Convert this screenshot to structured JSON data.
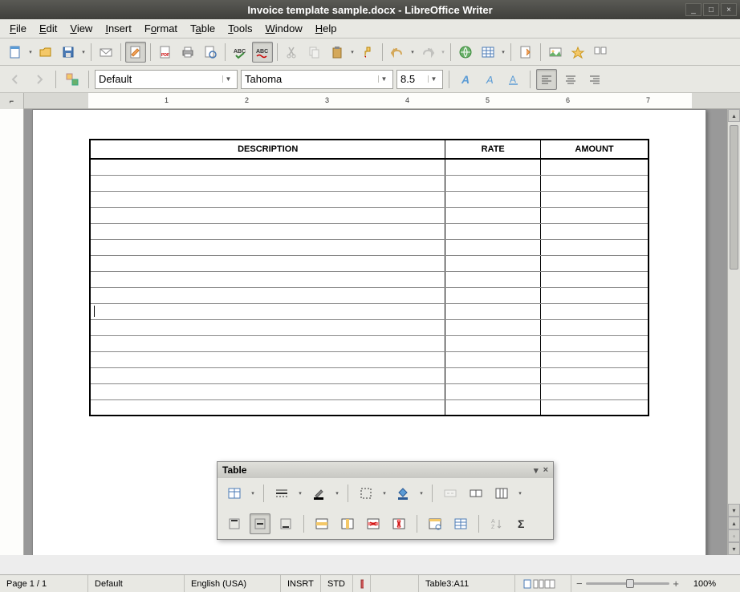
{
  "window": {
    "title": "Invoice template sample.docx - LibreOffice Writer"
  },
  "menu": {
    "file": "File",
    "edit": "Edit",
    "view": "View",
    "insert": "Insert",
    "format": "Format",
    "table": "Table",
    "tools": "Tools",
    "window": "Window",
    "help": "Help"
  },
  "format": {
    "style": "Default",
    "font": "Tahoma",
    "size": "8.5"
  },
  "table_headers": {
    "desc": "DESCRIPTION",
    "rate": "RATE",
    "amount": "AMOUNT"
  },
  "float_toolbar": {
    "title": "Table"
  },
  "status": {
    "page": "Page 1 / 1",
    "style": "Default",
    "lang": "English (USA)",
    "insrt": "INSRT",
    "std": "STD",
    "cell": "Table3:A11",
    "zoom": "100%"
  },
  "ruler": {
    "marks": [
      "1",
      "2",
      "3",
      "4",
      "5",
      "6",
      "7"
    ]
  }
}
